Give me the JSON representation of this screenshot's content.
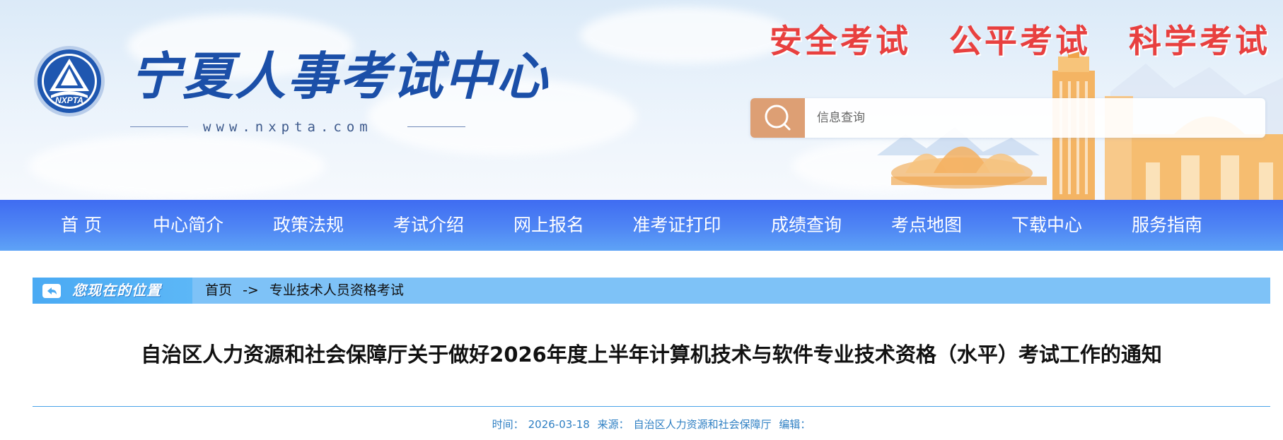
{
  "header": {
    "emblem_text": "NXPTA",
    "site_name": "宁夏人事考试中心",
    "site_url": "www.nxpta.com",
    "slogans": [
      "安全考试",
      "公平考试",
      "科学考试"
    ],
    "search": {
      "placeholder": "信息查询",
      "icon": "search-icon"
    },
    "colors": {
      "slogan": "#e8403f",
      "search_button": "#dd9f74",
      "site_name": "#1b4fa8"
    }
  },
  "nav": {
    "items": [
      {
        "label": "首 页"
      },
      {
        "label": "中心简介"
      },
      {
        "label": "政策法规"
      },
      {
        "label": "考试介绍"
      },
      {
        "label": "网上报名"
      },
      {
        "label": "准考证打印"
      },
      {
        "label": "成绩查询"
      },
      {
        "label": "考点地图"
      },
      {
        "label": "下载中心"
      },
      {
        "label": "服务指南"
      }
    ],
    "color": "#4f86f4"
  },
  "breadcrumb": {
    "tag_label": "您现在的位置",
    "icon": "return-arrow-icon",
    "items": [
      "首页",
      "专业技术人员资格考试"
    ],
    "separator": "->"
  },
  "article": {
    "title": "自治区人力资源和社会保障厅关于做好2026年度上半年计算机技术与软件专业技术资格（水平）考试工作的通知",
    "meta": {
      "time_label": "时间：",
      "time_value": "2026-03-18",
      "source_label": "来源：",
      "source_value": "自治区人力资源和社会保障厅",
      "editor_label": "编辑："
    }
  }
}
